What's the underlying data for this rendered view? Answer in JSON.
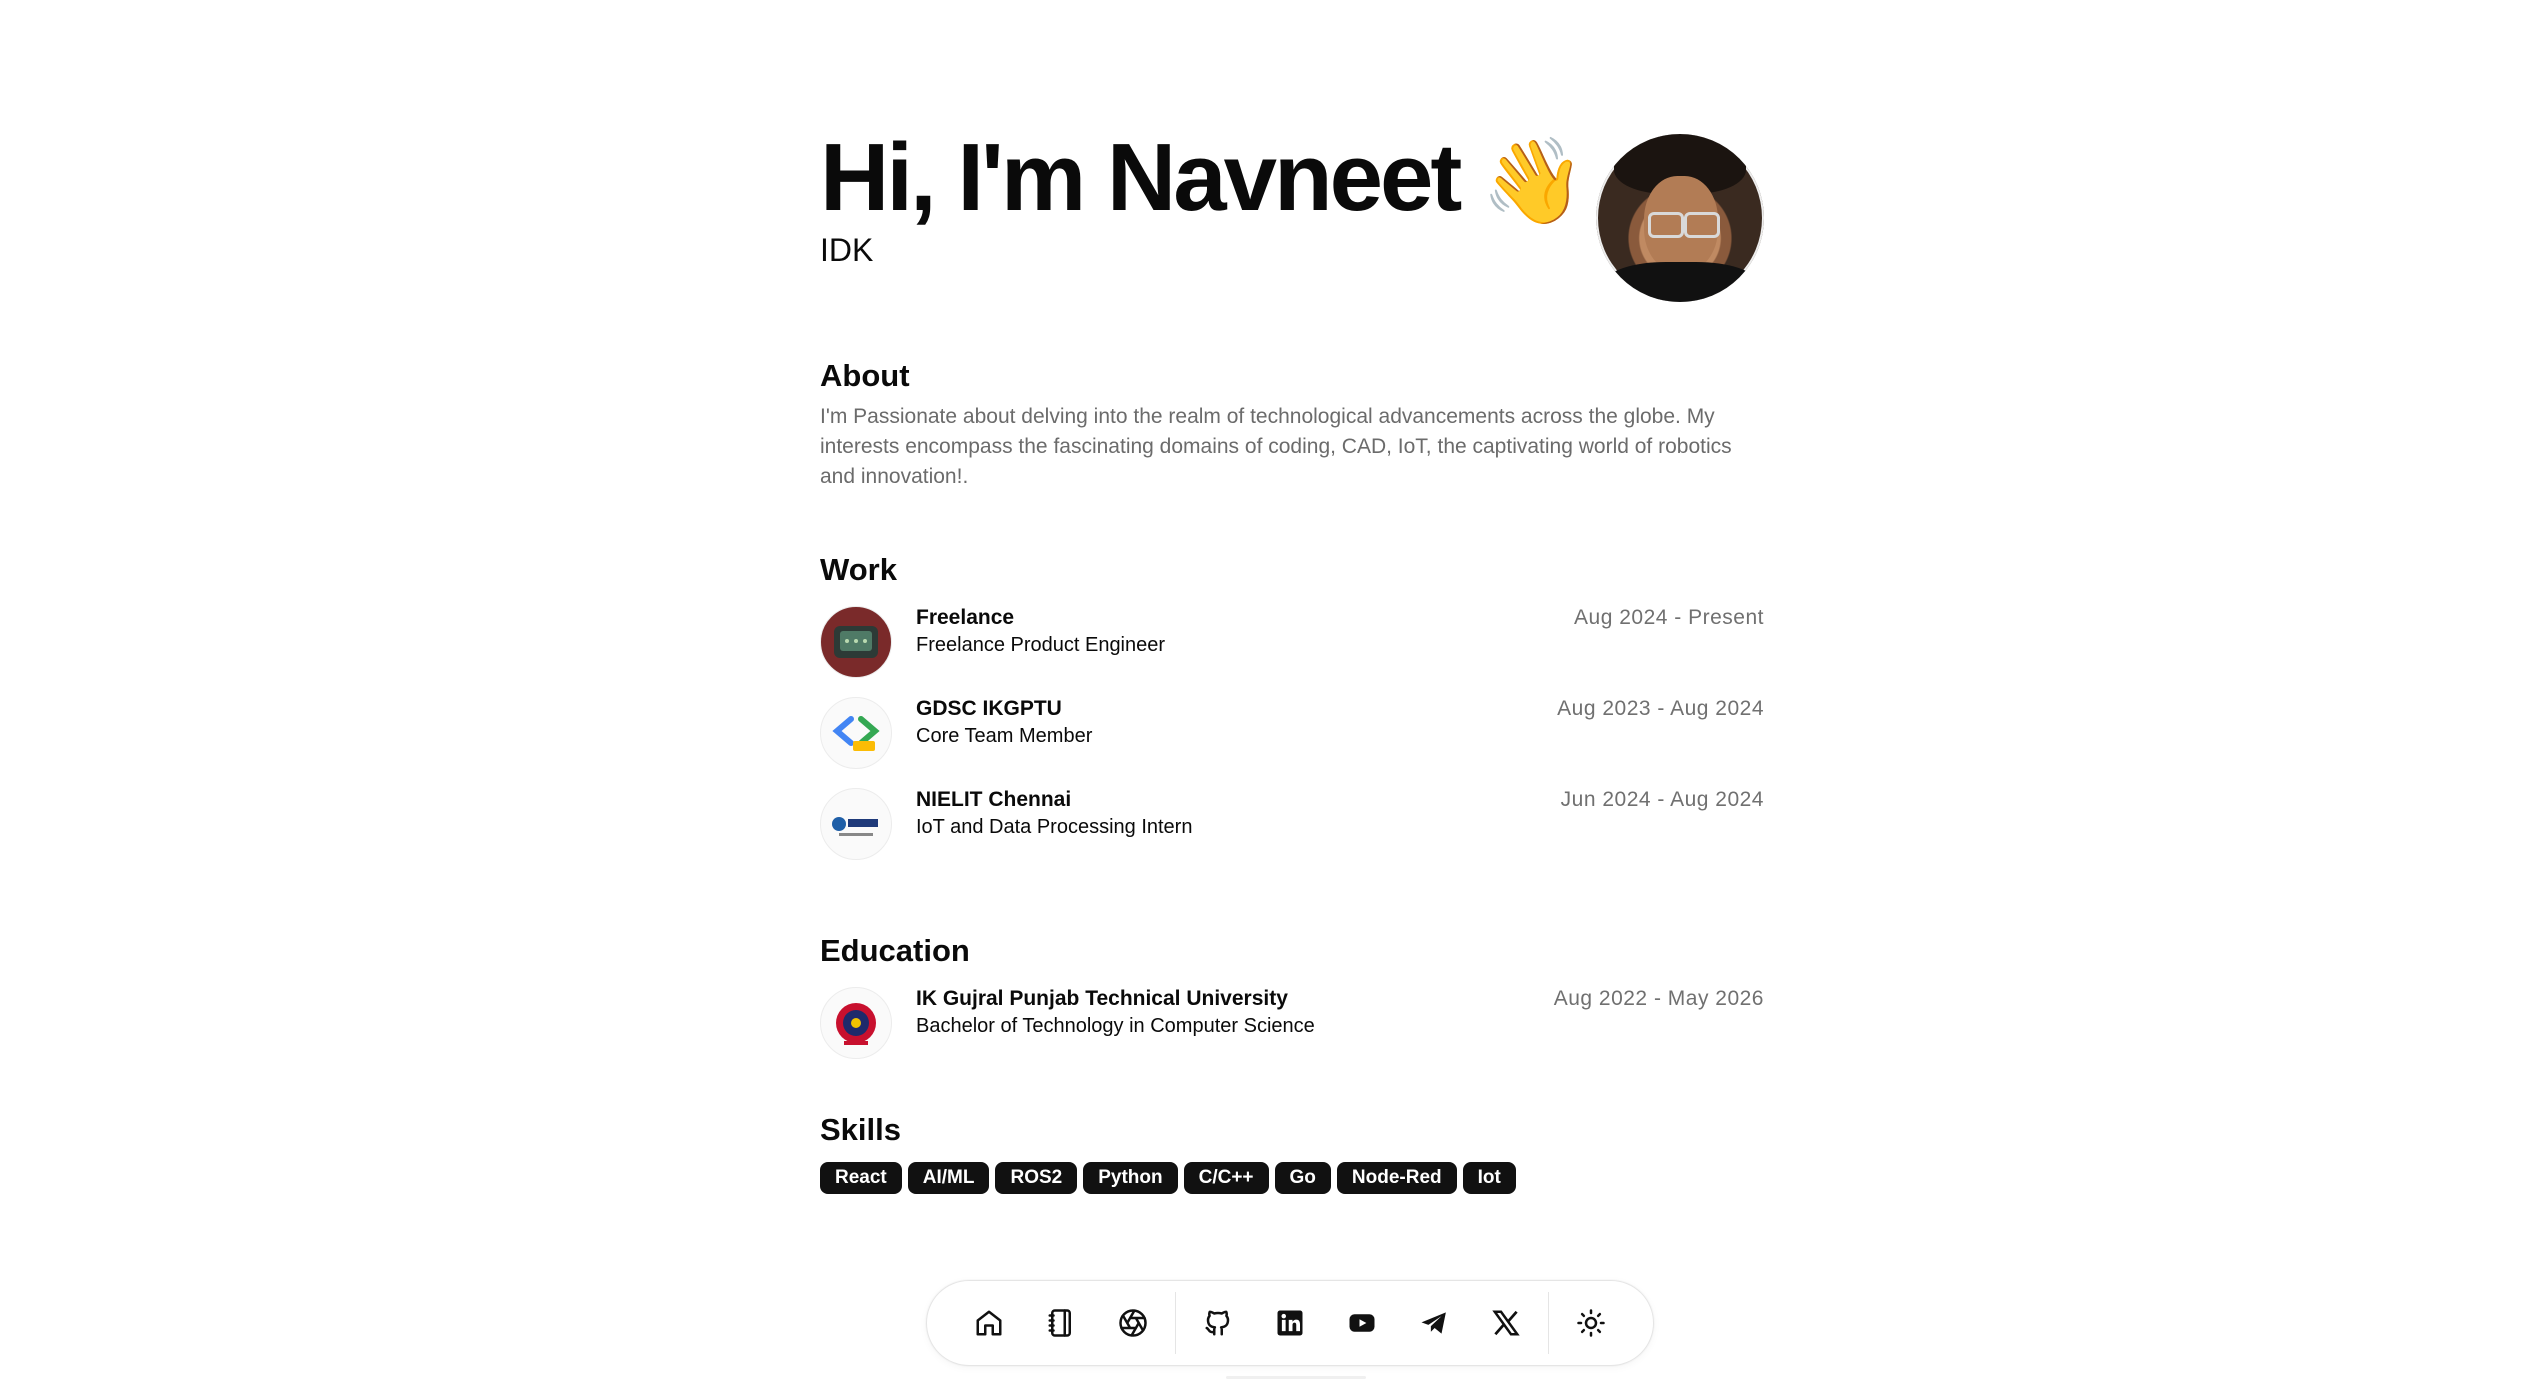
{
  "hero": {
    "title": "Hi, I'm Navneet",
    "wave": "👋",
    "subtitle": "IDK"
  },
  "about": {
    "title": "About",
    "text": "I'm Passionate about delving into the realm of technological advancements across the globe. My interests encompass the fascinating domains of coding, CAD, IoT, the captivating world of robotics and innovation!."
  },
  "work": {
    "title": "Work",
    "items": [
      {
        "name": "Freelance",
        "role": "Freelance Product Engineer",
        "dates": "Aug 2024 - Present"
      },
      {
        "name": "GDSC IKGPTU",
        "role": "Core Team Member",
        "dates": "Aug 2023 - Aug 2024"
      },
      {
        "name": "NIELIT Chennai",
        "role": "IoT and Data Processing Intern",
        "dates": "Jun 2024 - Aug 2024"
      }
    ]
  },
  "education": {
    "title": "Education",
    "items": [
      {
        "name": "IK Gujral Punjab Technical University",
        "degree": "Bachelor of Technology in Computer Science",
        "dates": "Aug 2022 - May 2026"
      }
    ]
  },
  "skills": {
    "title": "Skills",
    "items": [
      "React",
      "AI/ML",
      "ROS2",
      "Python",
      "C/C++",
      "Go",
      "Node-Red",
      "Iot"
    ]
  },
  "dock": {
    "icons": [
      "home-icon",
      "notebook-icon",
      "aperture-icon",
      "github-icon",
      "linkedin-icon",
      "youtube-icon",
      "telegram-icon",
      "x-icon",
      "sun-icon"
    ]
  }
}
